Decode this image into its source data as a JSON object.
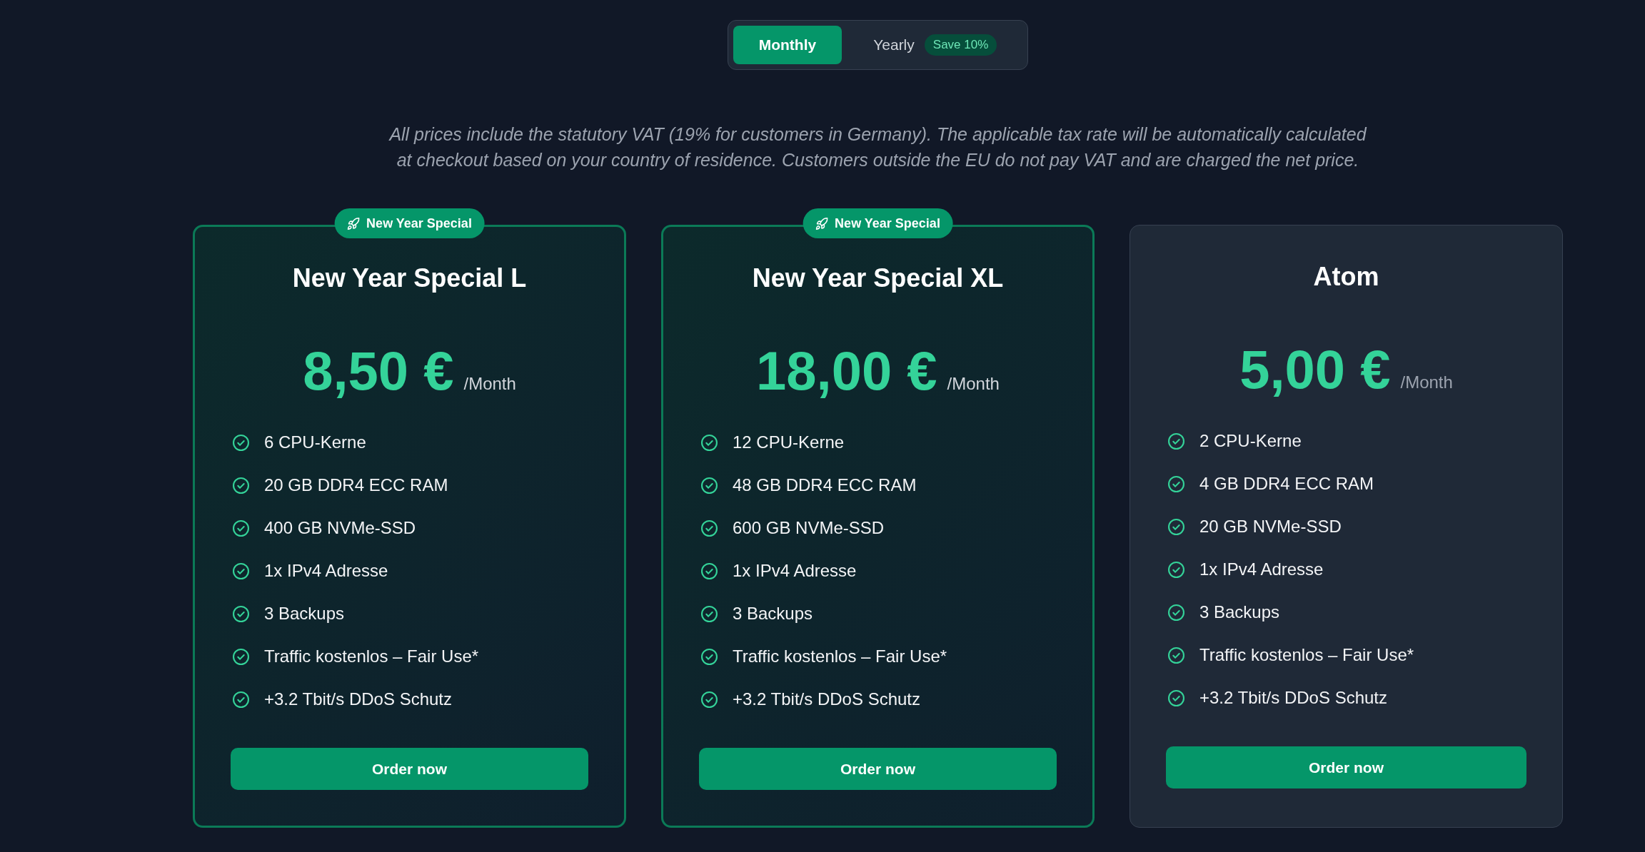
{
  "billing_toggle": {
    "options": [
      {
        "label": "Monthly",
        "selected": true
      },
      {
        "label": "Yearly",
        "selected": false,
        "badge": "Save 10%"
      }
    ]
  },
  "vat_note": "All prices include the statutory VAT (19% for customers in Germany). The applicable tax rate will be automatically calculated at checkout based on your country of residence. Customers outside the EU do not pay VAT and are charged the net price.",
  "plans": [
    {
      "badge": "New Year Special",
      "highlighted": true,
      "name": "New Year Special L",
      "price": "8,50 €",
      "period": "/Month",
      "features": [
        "6 CPU-Kerne",
        "20 GB DDR4 ECC RAM",
        "400 GB NVMe-SSD",
        "1x IPv4 Adresse",
        "3 Backups",
        "Traffic kostenlos – Fair Use*",
        "+3.2 Tbit/s DDoS Schutz"
      ],
      "button": "Order now"
    },
    {
      "badge": "New Year Special",
      "highlighted": true,
      "name": "New Year Special XL",
      "price": "18,00 €",
      "period": "/Month",
      "features": [
        "12 CPU-Kerne",
        "48 GB DDR4 ECC RAM",
        "600 GB NVMe-SSD",
        "1x IPv4 Adresse",
        "3 Backups",
        "Traffic kostenlos – Fair Use*",
        "+3.2 Tbit/s DDoS Schutz"
      ],
      "button": "Order now"
    },
    {
      "highlighted": false,
      "name": "Atom",
      "price": "5,00 €",
      "period": "/Month",
      "features": [
        "2 CPU-Kerne",
        "4 GB DDR4 ECC RAM",
        "20 GB NVMe-SSD",
        "1x IPv4 Adresse",
        "3 Backups",
        "Traffic kostenlos – Fair Use*",
        "+3.2 Tbit/s DDoS Schutz"
      ],
      "button": "Order now"
    }
  ]
}
